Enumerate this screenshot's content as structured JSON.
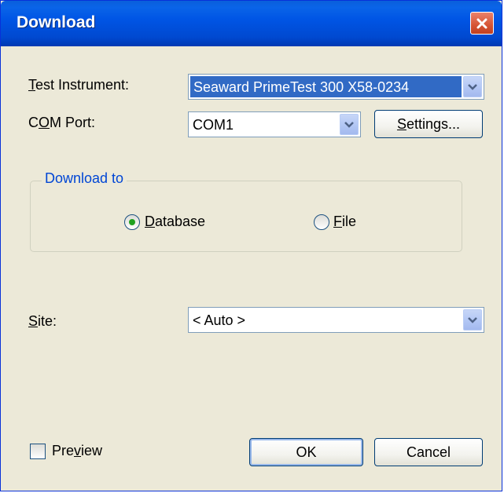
{
  "window": {
    "title": "Download"
  },
  "fields": {
    "instrument_label": {
      "pre": "",
      "accel": "T",
      "post": "est Instrument:"
    },
    "instrument_value": "Seaward PrimeTest 300 X58-0234",
    "com_label": {
      "pre": "C",
      "accel": "O",
      "post": "M Port:"
    },
    "com_value": "COM1",
    "settings_button": {
      "pre": "",
      "accel": "S",
      "post": "ettings..."
    },
    "site_label": {
      "pre": "",
      "accel": "S",
      "post": "ite:"
    },
    "site_value": "< Auto >"
  },
  "download_to": {
    "title": "Download to",
    "database": {
      "pre": "",
      "accel": "D",
      "post": "atabase",
      "selected": true
    },
    "file": {
      "pre": "",
      "accel": "F",
      "post": "ile",
      "selected": false
    }
  },
  "footer": {
    "preview": {
      "pre": "Pre",
      "accel": "v",
      "post": "iew",
      "checked": false
    },
    "ok_label": "OK",
    "cancel_label": "Cancel"
  },
  "colors": {
    "titlebar": "#0055e5",
    "close_button": "#d65434",
    "selection": "#316ac5",
    "radio_selected": "#21a121",
    "group_title": "#0046d5"
  },
  "icons": {
    "close": "close-icon",
    "dropdown": "chevron-down-icon"
  }
}
